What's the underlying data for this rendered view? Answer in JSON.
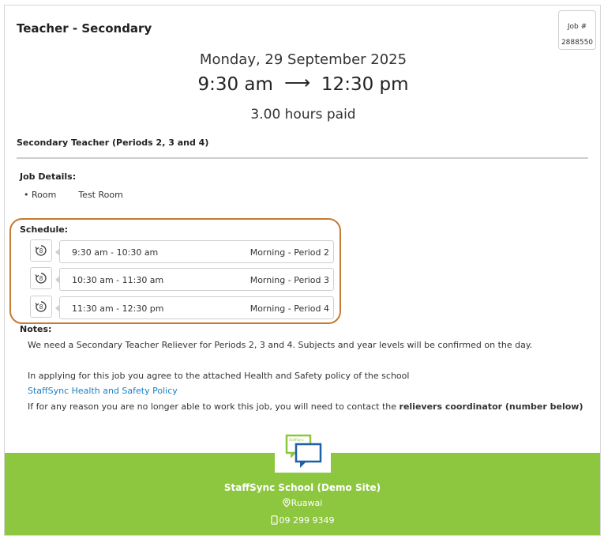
{
  "header": {
    "title": "Teacher - Secondary",
    "job_label": "Job #",
    "job_number": "2888550"
  },
  "summary": {
    "date": "Monday, 29 September 2025",
    "start": "9:30 am",
    "end": "12:30 pm",
    "arrow": "⟶",
    "hours_paid": "3.00 hours paid"
  },
  "subtitle": "Secondary Teacher (Periods 2, 3 and 4)",
  "job_details": {
    "label": "Job Details:",
    "items": [
      {
        "key": "Room",
        "value": "Test Room"
      }
    ]
  },
  "schedule": {
    "label": "Schedule:",
    "highlight_color": "#c67a33",
    "slots": [
      {
        "time": "9:30 am - 10:30 am",
        "period": "Morning - Period 2"
      },
      {
        "time": "10:30 am - 11:30 am",
        "period": "Morning - Period 3"
      },
      {
        "time": "11:30 am - 12:30 pm",
        "period": "Morning - Period 4"
      }
    ]
  },
  "notes": {
    "label": "Notes:",
    "line1": "We need a Secondary Teacher Reliever for Periods 2, 3 and 4. Subjects and year levels will be confirmed on the day.",
    "line2": "In applying for this job you agree to the attached Health and Safety policy of the school",
    "policy_link": "StaffSync Health and Safety Policy",
    "line3_prefix": "If for any reason you are no longer able to work this job, you will need to contact the ",
    "line3_bold": "relievers coordinator (number below)"
  },
  "footer": {
    "school": "StaffSync School (Demo Site)",
    "location": "Ruawai",
    "phone": "09 299 9349",
    "bg_color": "#8dc63f",
    "logo_text": "StaffSync"
  }
}
